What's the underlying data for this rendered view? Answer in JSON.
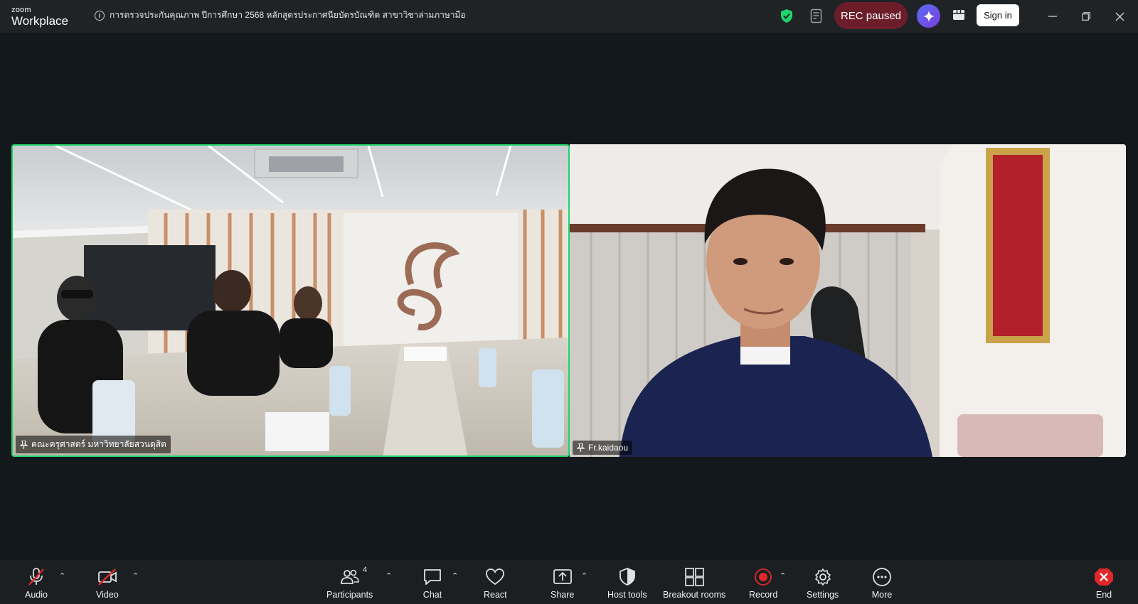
{
  "app": {
    "brand_top": "zoom",
    "brand_bottom": "Workplace"
  },
  "meeting": {
    "title": "การตรวจประกันคุณภาพ ปีการศึกษา 2568 หลักสูตรประกาศนียบัตรบัณฑิต สาขาวิชาล่ามภาษามือ"
  },
  "header": {
    "rec_label": "REC paused",
    "signin_label": "Sign in"
  },
  "participants_tiles": [
    {
      "name": "คณะครุศาสตร์ มหาวิทยาลัยสวนดุสิต",
      "active_speaker": true
    },
    {
      "name": "Fr.kaidaou",
      "active_speaker": false
    }
  ],
  "toolbar": {
    "audio": "Audio",
    "video": "Video",
    "participants": "Participants",
    "participants_count": "4",
    "chat": "Chat",
    "react": "React",
    "share": "Share",
    "host_tools": "Host tools",
    "breakout": "Breakout rooms",
    "record": "Record",
    "settings": "Settings",
    "more": "More",
    "end": "End"
  },
  "colors": {
    "active_border": "#1ed46b",
    "rec_pill": "#6b1e2a",
    "end_red": "#e02828",
    "record_red": "#e02828"
  }
}
